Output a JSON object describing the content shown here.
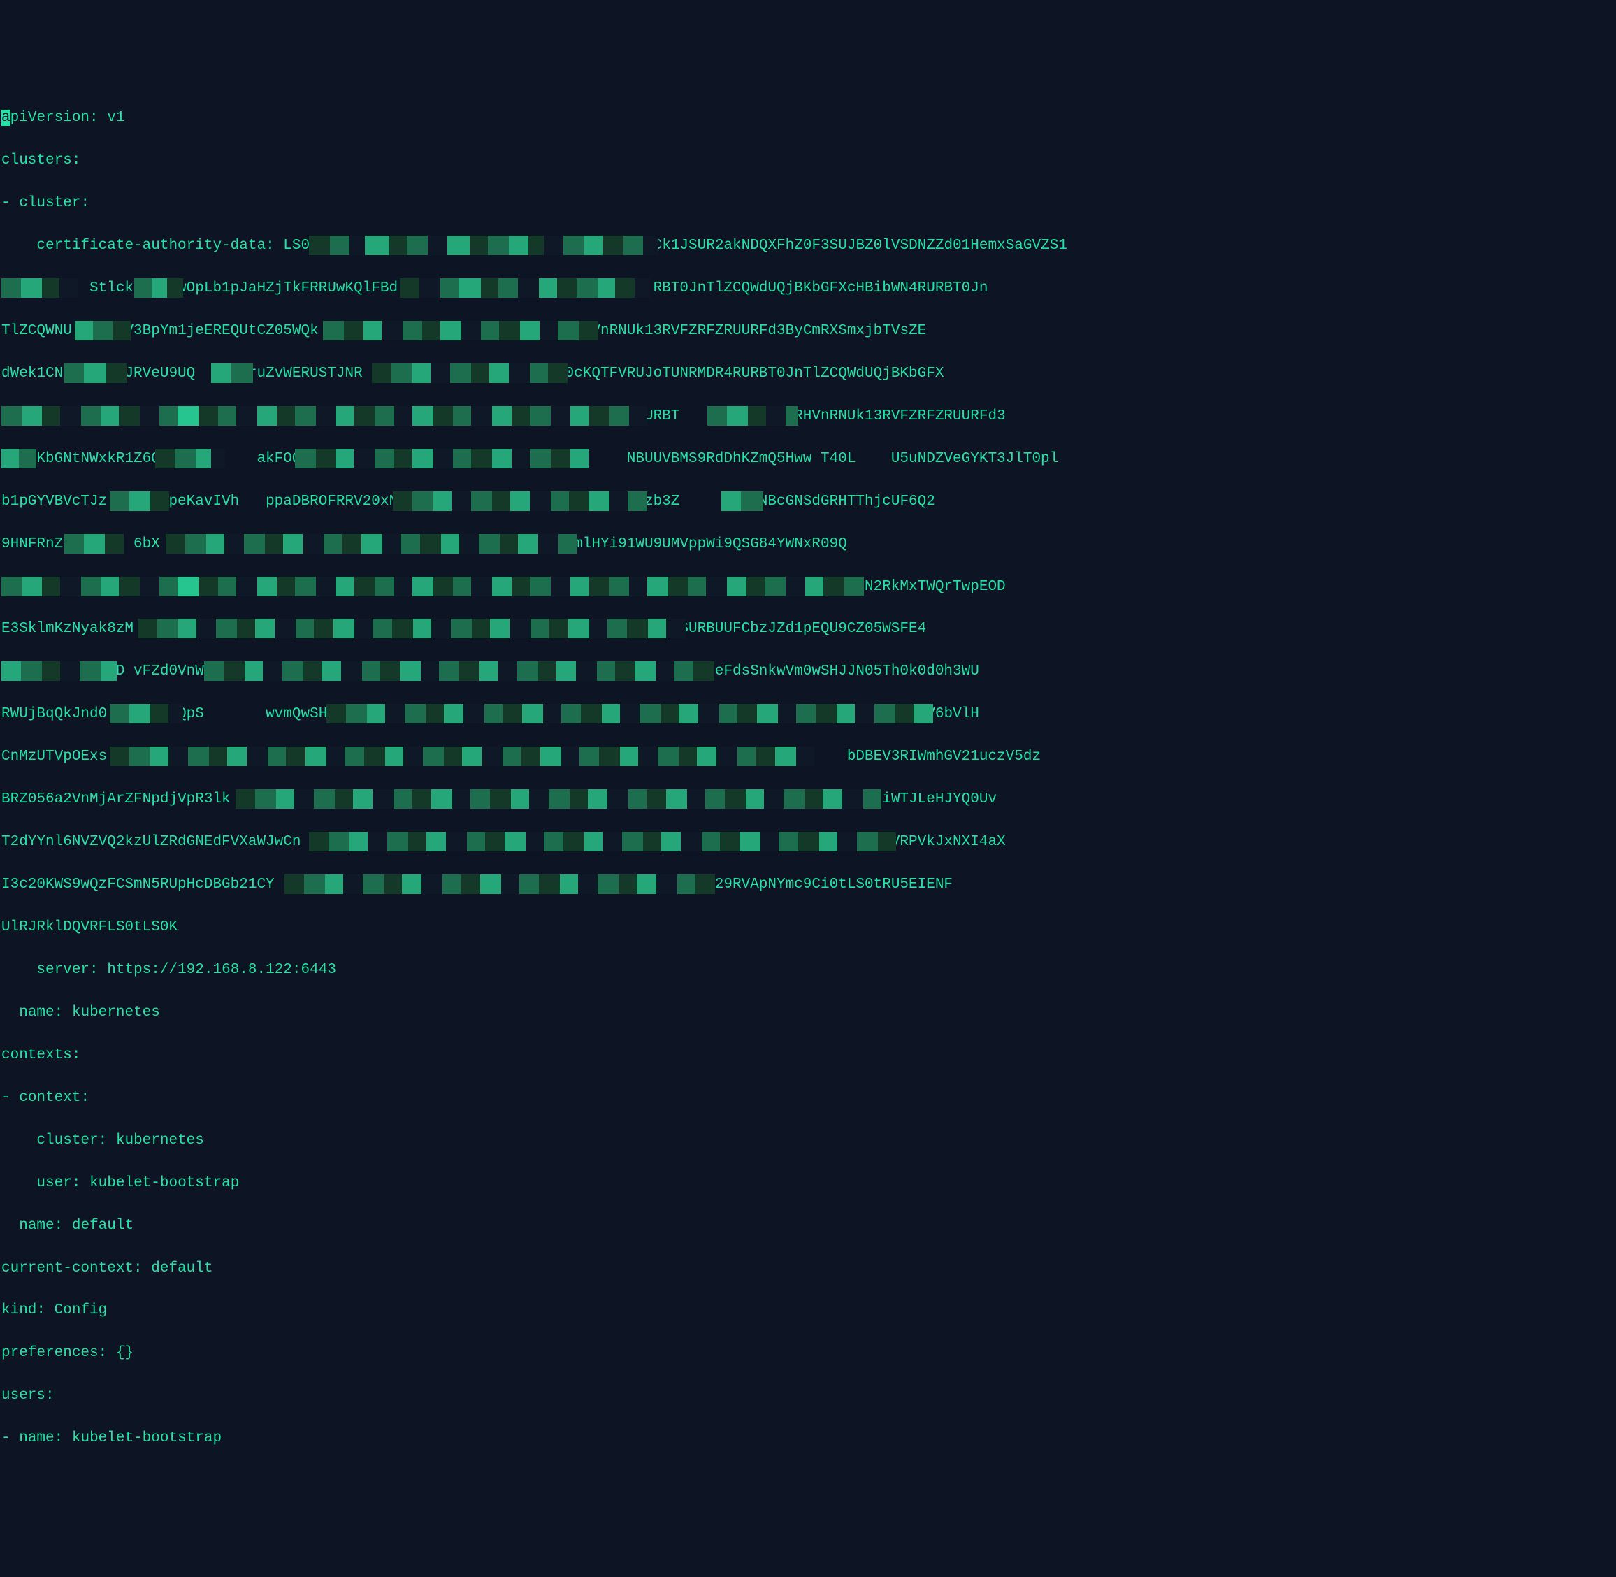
{
  "yaml": {
    "apiVersion_key": "apiVersion",
    "apiVersion_value": "v1",
    "clusters_key": "clusters",
    "cluster_key": "cluster",
    "cad_key": "certificate-authority-data",
    "cad_line1_left": "LS0t",
    "cad_line1_right": "LS0tCk1JSUR2akNDQXFhZ0F3SUJBZ0lVSDNZZd01HemxSaGVZS1",
    "cad_line2_left": "          Stlck",
    "cad_line2_mid": "wOpLb1pJaHZjTkFRRUwKQlFBd",
    "cad_line2_right": "RBT0JnTlZCQWdUQjBKbGFXcHBibWN4RURBT0Jn",
    "cad_line3_left": "TlZCQWNU",
    "cad_line3_mid": "V3BpYm1jeEREQUtCZ05WQk",
    "cad_line3_right": "semRHVnRNUk13RVFZRFZRUURFd3ByCmRXSmxjbTVsZE",
    "cad_line4_left": "dWek1CN",
    "cad_line4_mid": "JRVeU9UQ      ruZvWERUSTJNR",
    "cad_line4_right": "lRFTE1Ba0cKQTFVRUJoTUNRMDR4RURBT0JnTlZCQWdUQjBKbGFX",
    "cad_line5_right": "RURBT         NsemRHVnRNUk13RVFZRFZRUURFd3",
    "cad_line6_left": "    KbGNtNWxkR1Z6Q2s         akFOQmd",
    "cad_line6_right": "NBUUVBMS9RdDhKZmQ5Hww T40L    U5uNDZVeGYKT3JlT0pl",
    "cad_line7_left": "b1pGYVBVcTJz",
    "cad_line7_mid": "peKavIVh   ppaDBROFRRV20xN3M",
    "cad_line7_right": "Ngpzb3Z     L5dENBcGNSdGRHTThjcUF6Q2",
    "cad_line8_left": "9HNFRnZ",
    "cad_line8_mid": "F 6bX",
    "cad_line8_right": "LR emlHYi91WU9UMVppWi9QSG84YWNxR09Q",
    "cad_line9_right": "N2RkMxTWQrTwpEOD",
    "cad_line10_left": "E3SklmKzNyak8zM",
    "cad_line10_right": "J3SURBUUFCbzJZd1pEQU9CZ05WSFE4",
    "cad_line11_left": "             D vFZd0VnW",
    "cad_line11_right": "eFdsSnkwVm0wSHJJN05Th0k0d0h3WU",
    "cad_line12_left": "RWUjBqQkJnd0",
    "cad_line12_mid": "QpS       wvmQwSH",
    "cad_line12_right": "Rc1V6bVlH",
    "cad_line13_left": "CnMzUTVpOExs",
    "cad_line13_right": "bDBEV3RIWmhGV21uczV5dz",
    "cad_line14_left": "BRZ056a2VnMjArZFNpdjVpR3lk",
    "cad_line14_right": "iWTJLeHJYQ0Uv",
    "cad_line15_left": "T2dYYnl6NVZVQ2kzUlZRdGNEdFVXaWJwCn",
    "cad_line15_right": "VRPVkJxNXI4aX",
    "cad_line16_left": "I3c20KWS9wQzFCSmN5RUpHcDBGb21CY",
    "cad_line16_right": "4Z29RVApNYmc9Ci0tLS0tRU5EIENF",
    "cad_line17": "UlRJRklDQVRFLS0tLS0K",
    "server_key": "server",
    "server_value": "https://192.168.8.122:6443",
    "name_key": "name",
    "name_kubernetes": "kubernetes",
    "contexts_key": "contexts",
    "context_key": "context",
    "cluster_ref_key": "cluster",
    "user_key": "user",
    "user_value": "kubelet-bootstrap",
    "name_default": "default",
    "current_context_key": "current-context",
    "current_context_value": "default",
    "kind_key": "kind",
    "kind_value": "Config",
    "preferences_key": "preferences",
    "preferences_value": "{}",
    "users_key": "users"
  }
}
